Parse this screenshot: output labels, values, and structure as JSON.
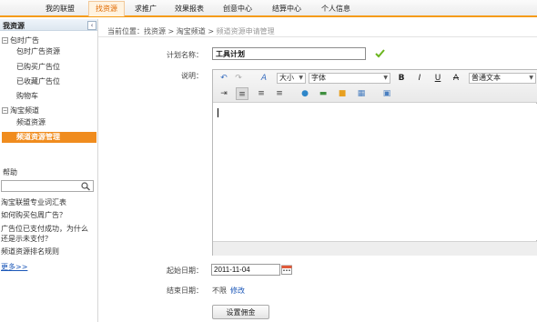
{
  "topnav": {
    "items": [
      "我的联盟",
      "找资源",
      "求推广",
      "效果报表",
      "创意中心",
      "结算中心",
      "个人信息"
    ],
    "active_index": 1
  },
  "sidebar": {
    "title": "我资源",
    "collapse_glyph": "‹",
    "groups": [
      {
        "toggle": "−",
        "label": "包时广告",
        "items": [
          "包时广告资源",
          "已购买广告位",
          "已收藏广告位",
          "购物车"
        ]
      },
      {
        "toggle": "−",
        "label": "淘宝频道",
        "items": [
          "频道资源",
          "频道资源管理"
        ]
      }
    ],
    "selected_item": "频道资源管理",
    "help": {
      "title": "帮助",
      "search_value": "",
      "links": [
        "淘宝联盟专业词汇表",
        "如何购买包周广告？",
        "广告位已支付成功，为什么",
        "还是示未支付？",
        "频道资源排名规则"
      ],
      "more": "更多>>"
    }
  },
  "breadcrumb": {
    "prefix": "当前位置：",
    "parts": [
      "找资源",
      "淘宝频道",
      "频道资源申请管理"
    ],
    "separator": " > "
  },
  "form": {
    "plan_name_label": "计划名称：",
    "plan_name_value": "工具计划",
    "description_label": "说明：",
    "start_date_label": "起始日期：",
    "start_date_value": "2011-11-04",
    "end_date_label": "结束日期：",
    "end_date_value": "不限",
    "modify_link": "修改",
    "submit_button": "设置佣金"
  },
  "editor": {
    "size_select": "大小",
    "font_select": "字体",
    "format_select": "普通文本",
    "buttons_row1": [
      "undo-icon",
      "redo-icon",
      "clear-format-icon",
      "bold-icon",
      "italic-icon",
      "underline-icon",
      "strikethrough-icon"
    ],
    "buttons_row2": [
      "indent-icon",
      "align-left-icon",
      "align-center-icon",
      "align-right-icon",
      "link-icon",
      "image-icon",
      "flash-icon",
      "table-icon",
      "emoticon-icon"
    ]
  },
  "colors": {
    "accent_orange": "#f08c1e",
    "nav_border": "#f59b15",
    "link_blue": "#1b57b8",
    "check_green": "#6bb51e"
  }
}
